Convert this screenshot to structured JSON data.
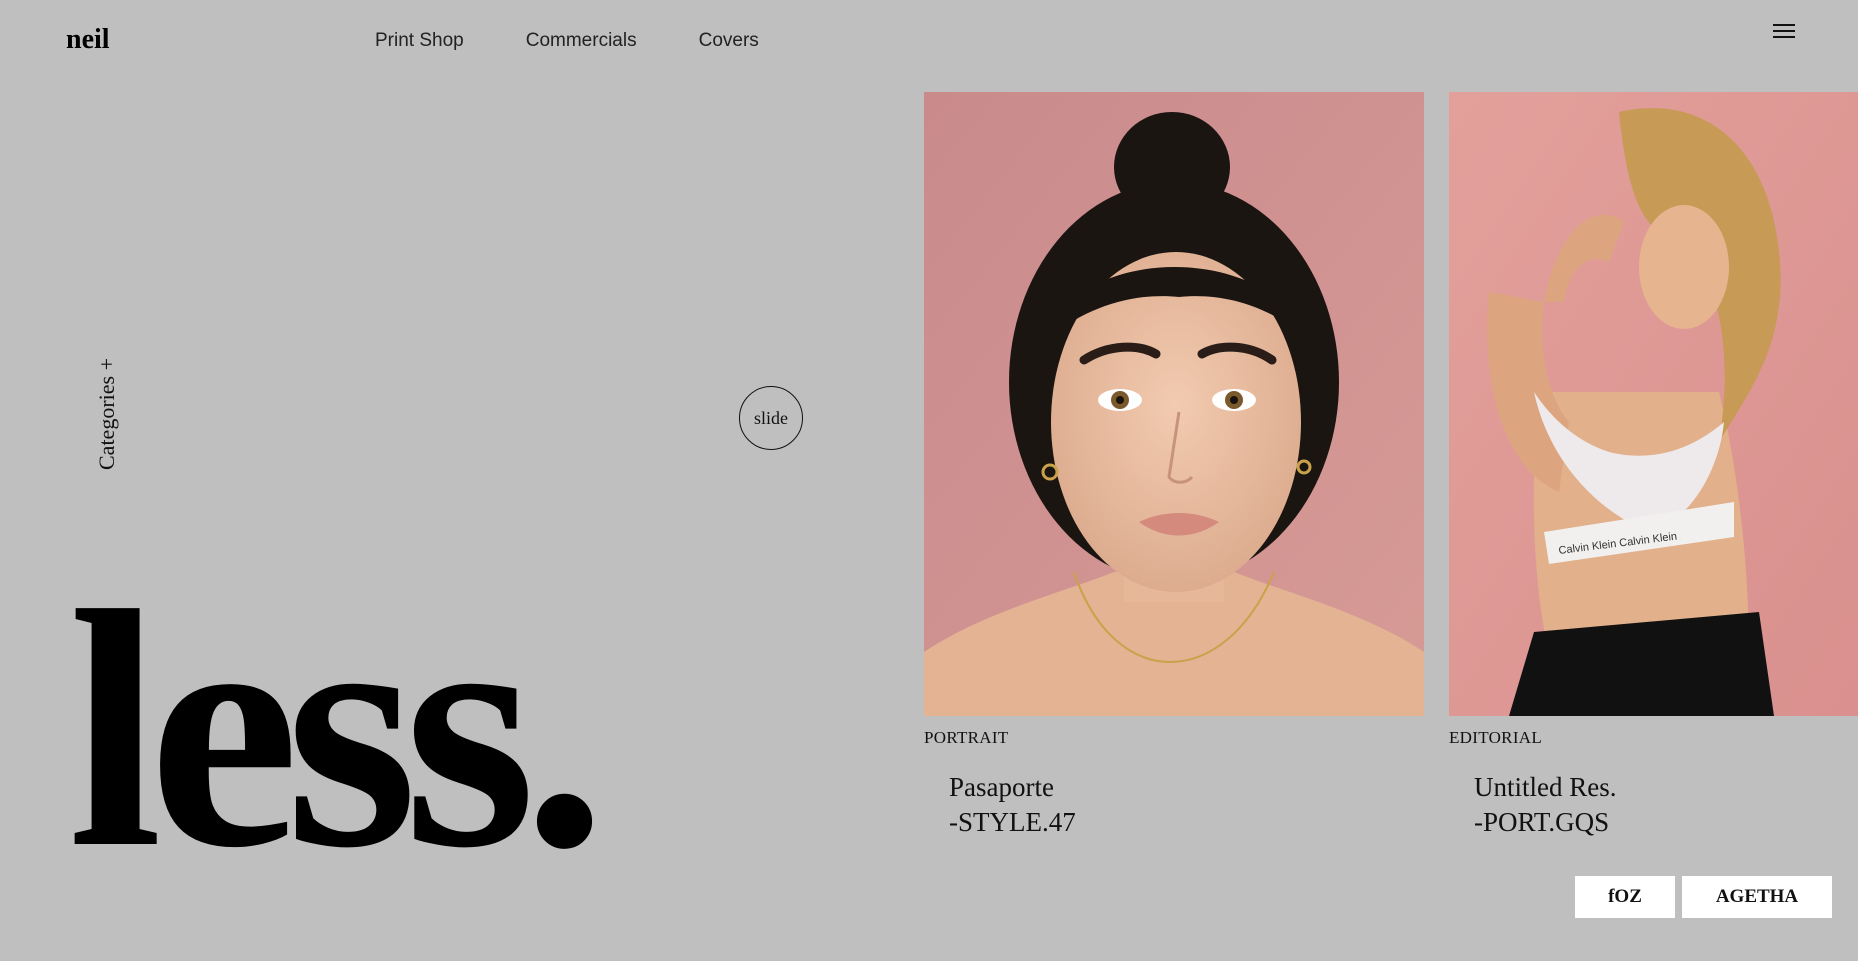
{
  "brand": {
    "logo": "neil"
  },
  "nav": {
    "items": [
      "Print Shop",
      "Commercials",
      "Covers"
    ]
  },
  "sidebar": {
    "categories_label": "Categories +"
  },
  "slider": {
    "label": "slide"
  },
  "hero": {
    "text": "less."
  },
  "cards": [
    {
      "category": "PORTRAIT",
      "title": "Pasaporte",
      "code": "-STYLE.47"
    },
    {
      "category": "EDITORIAL",
      "title": "Untitled Res.",
      "code": "-PORT.GQS"
    }
  ],
  "tags": [
    "fOZ",
    "AGETHA"
  ],
  "colors": {
    "background": "#bfbfbf",
    "photo_backdrop": "#d08f92",
    "photo_backdrop_2": "#e4a09c"
  }
}
